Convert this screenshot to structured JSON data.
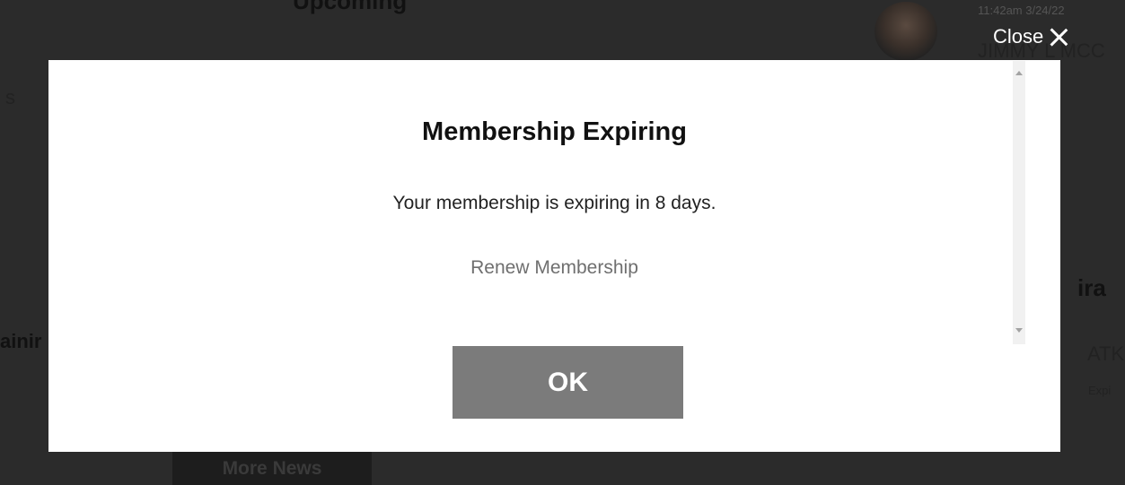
{
  "background": {
    "upcoming_heading": "Upcoming",
    "timestamp": "11:42am 3/24/22",
    "author_name": "JIMMY L MCC",
    "left_fragment_1": "s",
    "left_fragment_2": "ainir",
    "right_fragment_1": "ira",
    "right_fragment_2": "ATKI",
    "right_fragment_3": "Expi",
    "more_news_label": "More News"
  },
  "close": {
    "label": "Close"
  },
  "modal": {
    "title": "Membership Expiring",
    "message": "Your membership is expiring in 8 days.",
    "renew_link": "Renew Membership",
    "ok_label": "OK"
  },
  "colors": {
    "ok_button_bg": "#7b7b7b",
    "renew_link": "#6f6f6f",
    "backdrop": "#2e2e2e"
  }
}
